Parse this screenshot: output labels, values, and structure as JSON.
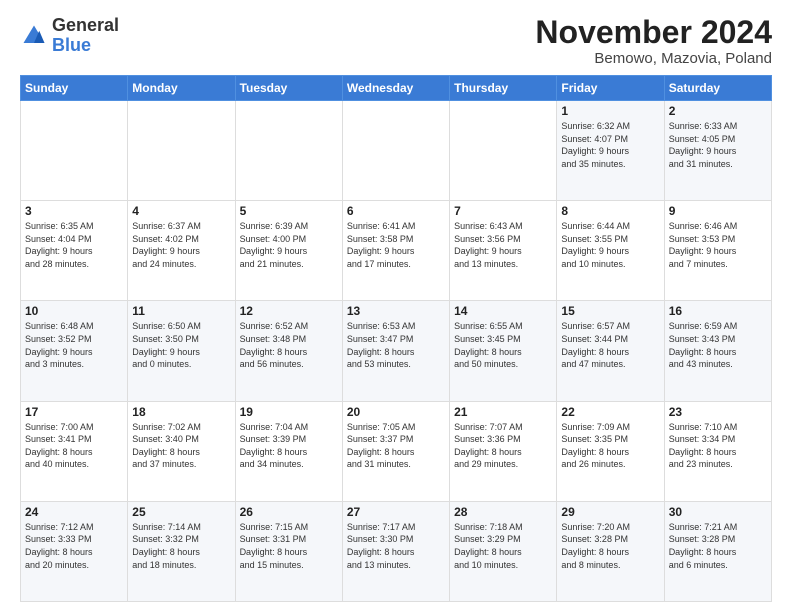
{
  "logo": {
    "general": "General",
    "blue": "Blue"
  },
  "title": "November 2024",
  "subtitle": "Bemowo, Mazovia, Poland",
  "headers": [
    "Sunday",
    "Monday",
    "Tuesday",
    "Wednesday",
    "Thursday",
    "Friday",
    "Saturday"
  ],
  "weeks": [
    [
      {
        "day": "",
        "info": ""
      },
      {
        "day": "",
        "info": ""
      },
      {
        "day": "",
        "info": ""
      },
      {
        "day": "",
        "info": ""
      },
      {
        "day": "",
        "info": ""
      },
      {
        "day": "1",
        "info": "Sunrise: 6:32 AM\nSunset: 4:07 PM\nDaylight: 9 hours\nand 35 minutes."
      },
      {
        "day": "2",
        "info": "Sunrise: 6:33 AM\nSunset: 4:05 PM\nDaylight: 9 hours\nand 31 minutes."
      }
    ],
    [
      {
        "day": "3",
        "info": "Sunrise: 6:35 AM\nSunset: 4:04 PM\nDaylight: 9 hours\nand 28 minutes."
      },
      {
        "day": "4",
        "info": "Sunrise: 6:37 AM\nSunset: 4:02 PM\nDaylight: 9 hours\nand 24 minutes."
      },
      {
        "day": "5",
        "info": "Sunrise: 6:39 AM\nSunset: 4:00 PM\nDaylight: 9 hours\nand 21 minutes."
      },
      {
        "day": "6",
        "info": "Sunrise: 6:41 AM\nSunset: 3:58 PM\nDaylight: 9 hours\nand 17 minutes."
      },
      {
        "day": "7",
        "info": "Sunrise: 6:43 AM\nSunset: 3:56 PM\nDaylight: 9 hours\nand 13 minutes."
      },
      {
        "day": "8",
        "info": "Sunrise: 6:44 AM\nSunset: 3:55 PM\nDaylight: 9 hours\nand 10 minutes."
      },
      {
        "day": "9",
        "info": "Sunrise: 6:46 AM\nSunset: 3:53 PM\nDaylight: 9 hours\nand 7 minutes."
      }
    ],
    [
      {
        "day": "10",
        "info": "Sunrise: 6:48 AM\nSunset: 3:52 PM\nDaylight: 9 hours\nand 3 minutes."
      },
      {
        "day": "11",
        "info": "Sunrise: 6:50 AM\nSunset: 3:50 PM\nDaylight: 9 hours\nand 0 minutes."
      },
      {
        "day": "12",
        "info": "Sunrise: 6:52 AM\nSunset: 3:48 PM\nDaylight: 8 hours\nand 56 minutes."
      },
      {
        "day": "13",
        "info": "Sunrise: 6:53 AM\nSunset: 3:47 PM\nDaylight: 8 hours\nand 53 minutes."
      },
      {
        "day": "14",
        "info": "Sunrise: 6:55 AM\nSunset: 3:45 PM\nDaylight: 8 hours\nand 50 minutes."
      },
      {
        "day": "15",
        "info": "Sunrise: 6:57 AM\nSunset: 3:44 PM\nDaylight: 8 hours\nand 47 minutes."
      },
      {
        "day": "16",
        "info": "Sunrise: 6:59 AM\nSunset: 3:43 PM\nDaylight: 8 hours\nand 43 minutes."
      }
    ],
    [
      {
        "day": "17",
        "info": "Sunrise: 7:00 AM\nSunset: 3:41 PM\nDaylight: 8 hours\nand 40 minutes."
      },
      {
        "day": "18",
        "info": "Sunrise: 7:02 AM\nSunset: 3:40 PM\nDaylight: 8 hours\nand 37 minutes."
      },
      {
        "day": "19",
        "info": "Sunrise: 7:04 AM\nSunset: 3:39 PM\nDaylight: 8 hours\nand 34 minutes."
      },
      {
        "day": "20",
        "info": "Sunrise: 7:05 AM\nSunset: 3:37 PM\nDaylight: 8 hours\nand 31 minutes."
      },
      {
        "day": "21",
        "info": "Sunrise: 7:07 AM\nSunset: 3:36 PM\nDaylight: 8 hours\nand 29 minutes."
      },
      {
        "day": "22",
        "info": "Sunrise: 7:09 AM\nSunset: 3:35 PM\nDaylight: 8 hours\nand 26 minutes."
      },
      {
        "day": "23",
        "info": "Sunrise: 7:10 AM\nSunset: 3:34 PM\nDaylight: 8 hours\nand 23 minutes."
      }
    ],
    [
      {
        "day": "24",
        "info": "Sunrise: 7:12 AM\nSunset: 3:33 PM\nDaylight: 8 hours\nand 20 minutes."
      },
      {
        "day": "25",
        "info": "Sunrise: 7:14 AM\nSunset: 3:32 PM\nDaylight: 8 hours\nand 18 minutes."
      },
      {
        "day": "26",
        "info": "Sunrise: 7:15 AM\nSunset: 3:31 PM\nDaylight: 8 hours\nand 15 minutes."
      },
      {
        "day": "27",
        "info": "Sunrise: 7:17 AM\nSunset: 3:30 PM\nDaylight: 8 hours\nand 13 minutes."
      },
      {
        "day": "28",
        "info": "Sunrise: 7:18 AM\nSunset: 3:29 PM\nDaylight: 8 hours\nand 10 minutes."
      },
      {
        "day": "29",
        "info": "Sunrise: 7:20 AM\nSunset: 3:28 PM\nDaylight: 8 hours\nand 8 minutes."
      },
      {
        "day": "30",
        "info": "Sunrise: 7:21 AM\nSunset: 3:28 PM\nDaylight: 8 hours\nand 6 minutes."
      }
    ]
  ]
}
